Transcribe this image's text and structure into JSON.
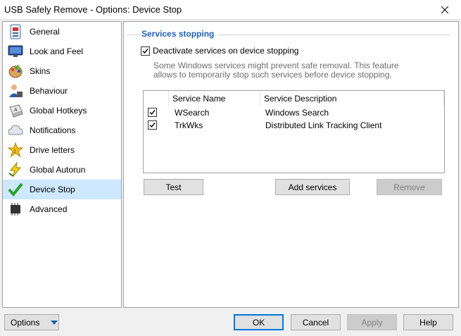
{
  "window": {
    "title": "USB Safely Remove - Options: Device Stop"
  },
  "sidebar": {
    "items": [
      {
        "label": "General",
        "icon": "general-icon"
      },
      {
        "label": "Look and Feel",
        "icon": "monitor-icon"
      },
      {
        "label": "Skins",
        "icon": "palette-icon"
      },
      {
        "label": "Behaviour",
        "icon": "person-icon"
      },
      {
        "label": "Global Hotkeys",
        "icon": "keyboard-icon"
      },
      {
        "label": "Notifications",
        "icon": "cloud-icon"
      },
      {
        "label": "Drive letters",
        "icon": "star-icon"
      },
      {
        "label": "Global Autorun",
        "icon": "lightning-icon"
      },
      {
        "label": "Device Stop",
        "icon": "check-icon"
      },
      {
        "label": "Advanced",
        "icon": "chip-icon"
      }
    ],
    "selected": "Device Stop"
  },
  "main": {
    "section_title": "Services stopping",
    "deactivate_label": "Deactivate services on device stopping",
    "deactivate_checked": true,
    "hint": "Some Windows services might prevent safe removal. This feature allows to temporarily stop such services before device stopping.",
    "list": {
      "columns": [
        "Service Name",
        "Service Description"
      ],
      "rows": [
        {
          "checked": true,
          "name": "WSearch",
          "description": "Windows Search"
        },
        {
          "checked": true,
          "name": "TrkWks",
          "description": "Distributed Link Tracking Client"
        }
      ]
    },
    "buttons": {
      "test": "Test",
      "add": "Add services",
      "remove": "Remove"
    }
  },
  "footer": {
    "options": "Options",
    "ok": "OK",
    "cancel": "Cancel",
    "apply": "Apply",
    "help": "Help"
  },
  "colors": {
    "accent": "#1e5fb4",
    "selection": "#cde8ff",
    "focus": "#0078d7"
  }
}
